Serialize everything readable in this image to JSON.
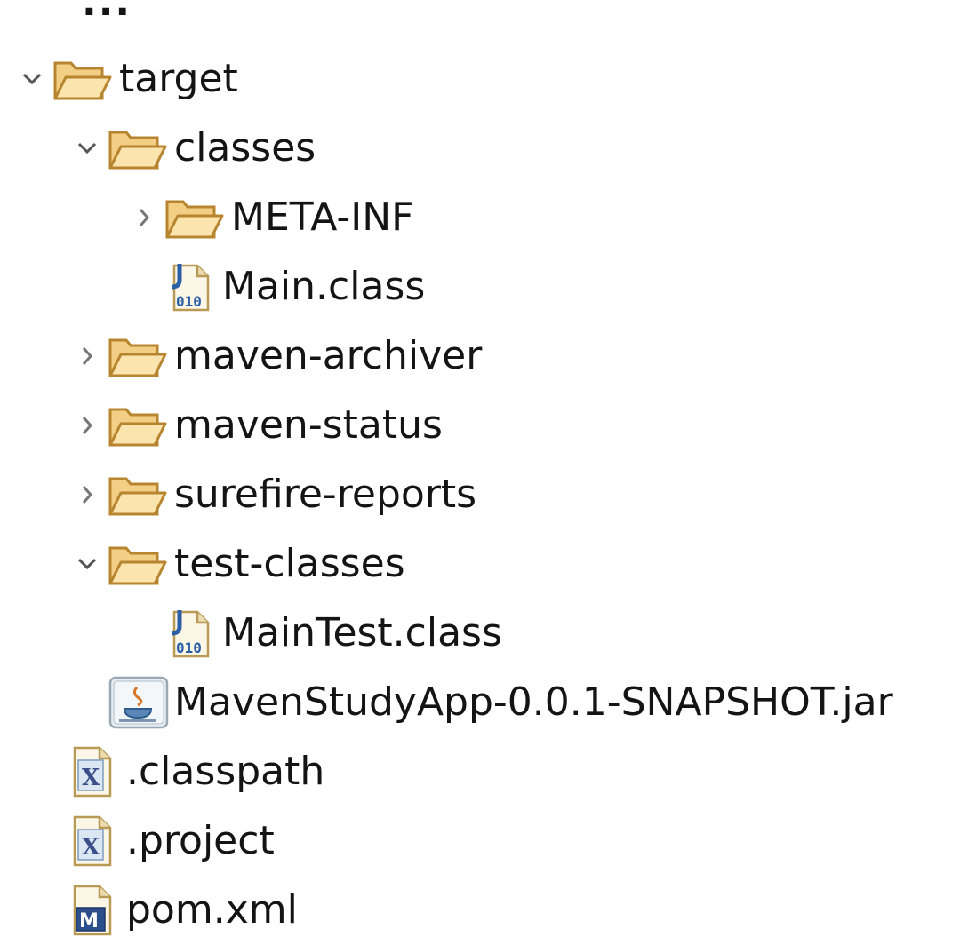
{
  "ellipsis": "...",
  "tree": [
    {
      "label": "target",
      "icon": "folder-icon",
      "expander": "expanded"
    },
    {
      "label": "classes",
      "icon": "folder-icon",
      "expander": "expanded"
    },
    {
      "label": "META-INF",
      "icon": "folder-icon",
      "expander": "collapsed"
    },
    {
      "label": "Main.class",
      "icon": "java-class-file-icon",
      "expander": "none"
    },
    {
      "label": "maven-archiver",
      "icon": "folder-icon",
      "expander": "collapsed"
    },
    {
      "label": "maven-status",
      "icon": "folder-icon",
      "expander": "collapsed"
    },
    {
      "label": "surefire-reports",
      "icon": "folder-icon",
      "expander": "collapsed"
    },
    {
      "label": "test-classes",
      "icon": "folder-icon",
      "expander": "expanded"
    },
    {
      "label": "MainTest.class",
      "icon": "java-class-file-icon",
      "expander": "none"
    },
    {
      "label": "MavenStudyApp-0.0.1-SNAPSHOT.jar",
      "icon": "jar-file-icon",
      "expander": "none"
    },
    {
      "label": ".classpath",
      "icon": "xml-file-icon",
      "expander": "none"
    },
    {
      "label": ".project",
      "icon": "xml-file-icon",
      "expander": "none"
    },
    {
      "label": "pom.xml",
      "icon": "maven-pom-icon",
      "expander": "none"
    }
  ],
  "colors": {
    "folder_fill": "#f6d58e",
    "folder_stroke": "#b7842f",
    "chevron": "#555555",
    "class_blue": "#2a5fa8"
  }
}
